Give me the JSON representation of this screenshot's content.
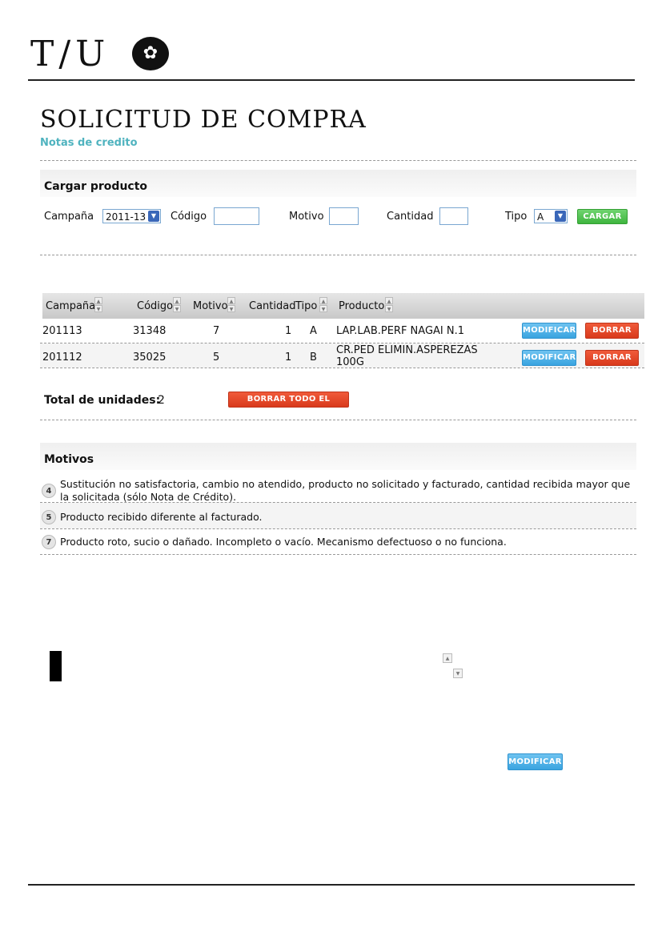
{
  "brand": {
    "logo_text": "T/U",
    "logo_symbol": "✿"
  },
  "header": {
    "title": "SOLICITUD DE COMPRA",
    "subtitle": "Notas de credito"
  },
  "cargar": {
    "heading": "Cargar producto",
    "campana_label": "Campaña",
    "campana_value": "2011-13",
    "codigo_label": "Código",
    "motivo_label": "Motivo",
    "cantidad_label": "Cantidad",
    "tipo_label": "Tipo",
    "tipo_value": "A",
    "submit_label": "CARGAR"
  },
  "table": {
    "headers": [
      "Campaña",
      "Código",
      "Motivo",
      "Cantidad",
      "Tipo",
      "Producto"
    ],
    "rows": [
      {
        "campana": "201113",
        "codigo": "31348",
        "motivo": "7",
        "cantidad": "1",
        "tipo": "A",
        "producto": "LAP.LAB.PERF NAGAI N.1",
        "modify": "MODIFICAR",
        "delete": "BORRAR"
      },
      {
        "campana": "201112",
        "codigo": "35025",
        "motivo": "5",
        "cantidad": "1",
        "tipo": "B",
        "producto": "CR.PED ELIMIN.ASPEREZAS 100G",
        "modify": "MODIFICAR",
        "delete": "BORRAR"
      }
    ]
  },
  "totals": {
    "label": "Total de unidades:",
    "value": "2",
    "delete_all": "BORRAR TODO EL PEDIDO"
  },
  "motivos": {
    "heading": "Motivos",
    "items": [
      {
        "num": "4",
        "text": "Sustitución no satisfactoria, cambio no atendido, producto no solicitado y facturado, cantidad recibida mayor que la solicitada (sólo Nota de Crédito)."
      },
      {
        "num": "5",
        "text": "Producto recibido diferente al facturado."
      },
      {
        "num": "7",
        "text": "Producto roto, sucio o dañado. Incompleto o vacío. Mecanismo defectuoso o no funciona."
      }
    ]
  },
  "stray": {
    "modify_label": "MODIFICAR"
  }
}
